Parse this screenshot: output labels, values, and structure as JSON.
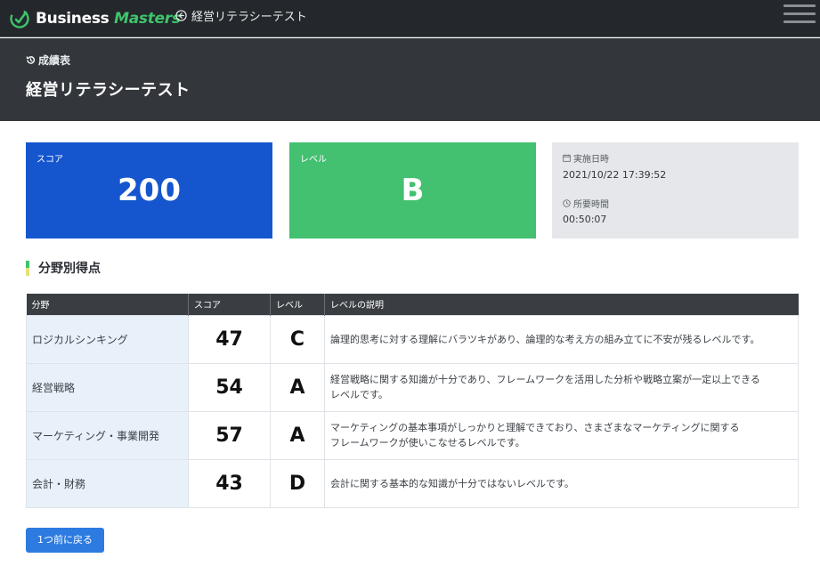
{
  "navbar": {
    "brand_part1": "Business ",
    "brand_part2": "Masters",
    "back_link": "経営リテラシーテスト"
  },
  "header": {
    "breadcrumb": "成績表",
    "title": "経営リテラシーテスト"
  },
  "summary": {
    "score_label": "スコア",
    "score_value": "200",
    "level_label": "レベル",
    "level_value": "B",
    "date_label": "実施日時",
    "date_value": "2021/10/22 17:39:52",
    "duration_label": "所要時間",
    "duration_value": "00:50:07"
  },
  "colors": {
    "score_card": "#1556cf",
    "level_card": "#43c070",
    "info_card": "#e5e7ea",
    "navbar": "#24272b",
    "header": "#33373c",
    "button": "#2d7be0"
  },
  "section": {
    "title": "分野別得点"
  },
  "table": {
    "headers": [
      "分野",
      "スコア",
      "レベル",
      "レベルの説明"
    ],
    "rows": [
      {
        "field": "ロジカルシンキング",
        "score": "47",
        "level": "C",
        "desc1": "論理的思考に対する理解にバラツキがあり、論理的な考え方の組み立てに不安が残るレベルです。",
        "desc2": ""
      },
      {
        "field": "経営戦略",
        "score": "54",
        "level": "A",
        "desc1": "経営戦略に関する知識が十分であり、フレームワークを活用した分析や戦略立案が一定以上できる",
        "desc2": "レベルです。"
      },
      {
        "field": "マーケティング・事業開発",
        "score": "57",
        "level": "A",
        "desc1": "マーケティングの基本事項がしっかりと理解できており、さまざまなマーケティングに関する",
        "desc2": "フレームワークが使いこなせるレベルです。"
      },
      {
        "field": "会計・財務",
        "score": "43",
        "level": "D",
        "desc1": "会計に関する基本的な知識が十分ではないレベルです。",
        "desc2": ""
      }
    ]
  },
  "actions": {
    "back_button": "1つ前に戻る"
  },
  "icons": {
    "brand": "brand-logo-icon",
    "back": "circle-arrow-left-icon",
    "menu": "hamburger-icon",
    "history": "history-icon",
    "calendar": "calendar-icon",
    "clock": "clock-icon"
  }
}
